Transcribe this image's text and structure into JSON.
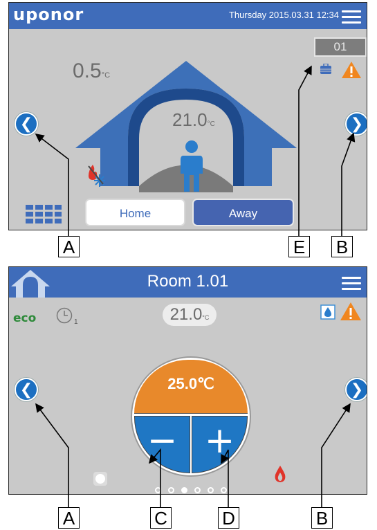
{
  "screen1": {
    "logo": "uponor",
    "datetime": "Thursday 2015.03.31  12:34",
    "outdoor_temp": "0.5",
    "outdoor_unit": "°C",
    "house_temp": "21.0",
    "house_unit": "°C",
    "room_badge": "01",
    "home_button": "Home",
    "away_button": "Away",
    "prev_glyph": "❮",
    "next_glyph": "❯"
  },
  "screen2": {
    "room_title": "Room 1.01",
    "eco_label": "eco",
    "schedule_index": "1",
    "current_temp": "21.0",
    "current_unit": "°C",
    "setpoint": "25.0℃",
    "minus_glyph": "−",
    "plus_glyph": "+",
    "prev_glyph": "❮",
    "next_glyph": "❯",
    "page_dots": 6,
    "active_dot": 2
  },
  "callouts": {
    "A": "A",
    "B": "B",
    "C": "C",
    "D": "D",
    "E": "E"
  },
  "colors": {
    "header_blue": "#3f6cba",
    "screen_grey": "#c9c9c9",
    "house_blue": "#3d70b8",
    "nav_blue": "#1c6fc1",
    "setpoint_orange": "#e8892b",
    "warning_orange": "#f0861f",
    "flame_red": "#e0342a"
  }
}
